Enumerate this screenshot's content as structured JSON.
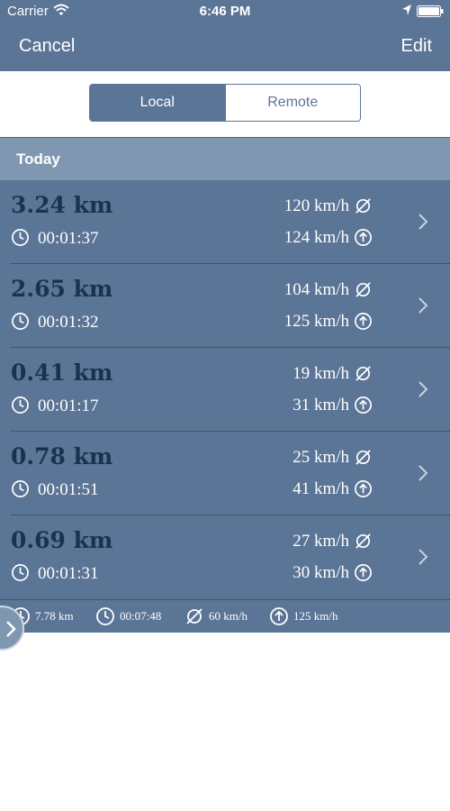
{
  "status": {
    "carrier": "Carrier",
    "time": "6:46 PM"
  },
  "nav": {
    "cancel": "Cancel",
    "edit": "Edit"
  },
  "segments": {
    "local": "Local",
    "remote": "Remote",
    "selected": "Local"
  },
  "section": {
    "title": "Today"
  },
  "rides": [
    {
      "distance": "3.24 km",
      "duration": "00:01:37",
      "avg_speed": "120 km/h",
      "max_speed": "124 km/h"
    },
    {
      "distance": "2.65 km",
      "duration": "00:01:32",
      "avg_speed": "104 km/h",
      "max_speed": "125 km/h"
    },
    {
      "distance": "0.41 km",
      "duration": "00:01:17",
      "avg_speed": "19 km/h",
      "max_speed": "31 km/h"
    },
    {
      "distance": "0.78 km",
      "duration": "00:01:51",
      "avg_speed": "25 km/h",
      "max_speed": "41 km/h"
    },
    {
      "distance": "0.69 km",
      "duration": "00:01:31",
      "avg_speed": "27 km/h",
      "max_speed": "30 km/h"
    }
  ],
  "totals": {
    "distance": "7.78 km",
    "duration": "00:07:48",
    "avg_speed": "60 km/h",
    "max_speed": "125 km/h"
  },
  "icons": {
    "duration": "clock-icon",
    "avg_speed": "average-symbol-icon",
    "max_speed": "arrow-up-circle-icon",
    "row_action": "chevron-right-icon",
    "total_distance": "distance-icon",
    "expand": "chevron-right-icon"
  },
  "colors": {
    "bar": "#5b7596",
    "section": "#7f97b0",
    "distance_text": "#173352",
    "text": "#ffffff",
    "background": "#ffffff"
  }
}
